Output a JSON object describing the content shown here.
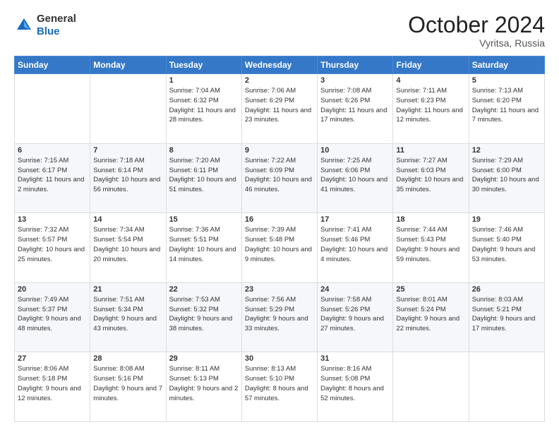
{
  "header": {
    "logo_general": "General",
    "logo_blue": "Blue",
    "month": "October 2024",
    "location": "Vyritsa, Russia"
  },
  "days_of_week": [
    "Sunday",
    "Monday",
    "Tuesday",
    "Wednesday",
    "Thursday",
    "Friday",
    "Saturday"
  ],
  "weeks": [
    [
      {
        "day": "",
        "info": ""
      },
      {
        "day": "",
        "info": ""
      },
      {
        "day": "1",
        "info": "Sunrise: 7:04 AM\nSunset: 6:32 PM\nDaylight: 11 hours and 28 minutes."
      },
      {
        "day": "2",
        "info": "Sunrise: 7:06 AM\nSunset: 6:29 PM\nDaylight: 11 hours and 23 minutes."
      },
      {
        "day": "3",
        "info": "Sunrise: 7:08 AM\nSunset: 6:26 PM\nDaylight: 11 hours and 17 minutes."
      },
      {
        "day": "4",
        "info": "Sunrise: 7:11 AM\nSunset: 6:23 PM\nDaylight: 11 hours and 12 minutes."
      },
      {
        "day": "5",
        "info": "Sunrise: 7:13 AM\nSunset: 6:20 PM\nDaylight: 11 hours and 7 minutes."
      }
    ],
    [
      {
        "day": "6",
        "info": "Sunrise: 7:15 AM\nSunset: 6:17 PM\nDaylight: 11 hours and 2 minutes."
      },
      {
        "day": "7",
        "info": "Sunrise: 7:18 AM\nSunset: 6:14 PM\nDaylight: 10 hours and 56 minutes."
      },
      {
        "day": "8",
        "info": "Sunrise: 7:20 AM\nSunset: 6:11 PM\nDaylight: 10 hours and 51 minutes."
      },
      {
        "day": "9",
        "info": "Sunrise: 7:22 AM\nSunset: 6:09 PM\nDaylight: 10 hours and 46 minutes."
      },
      {
        "day": "10",
        "info": "Sunrise: 7:25 AM\nSunset: 6:06 PM\nDaylight: 10 hours and 41 minutes."
      },
      {
        "day": "11",
        "info": "Sunrise: 7:27 AM\nSunset: 6:03 PM\nDaylight: 10 hours and 35 minutes."
      },
      {
        "day": "12",
        "info": "Sunrise: 7:29 AM\nSunset: 6:00 PM\nDaylight: 10 hours and 30 minutes."
      }
    ],
    [
      {
        "day": "13",
        "info": "Sunrise: 7:32 AM\nSunset: 5:57 PM\nDaylight: 10 hours and 25 minutes."
      },
      {
        "day": "14",
        "info": "Sunrise: 7:34 AM\nSunset: 5:54 PM\nDaylight: 10 hours and 20 minutes."
      },
      {
        "day": "15",
        "info": "Sunrise: 7:36 AM\nSunset: 5:51 PM\nDaylight: 10 hours and 14 minutes."
      },
      {
        "day": "16",
        "info": "Sunrise: 7:39 AM\nSunset: 5:48 PM\nDaylight: 10 hours and 9 minutes."
      },
      {
        "day": "17",
        "info": "Sunrise: 7:41 AM\nSunset: 5:46 PM\nDaylight: 10 hours and 4 minutes."
      },
      {
        "day": "18",
        "info": "Sunrise: 7:44 AM\nSunset: 5:43 PM\nDaylight: 9 hours and 59 minutes."
      },
      {
        "day": "19",
        "info": "Sunrise: 7:46 AM\nSunset: 5:40 PM\nDaylight: 9 hours and 53 minutes."
      }
    ],
    [
      {
        "day": "20",
        "info": "Sunrise: 7:49 AM\nSunset: 5:37 PM\nDaylight: 9 hours and 48 minutes."
      },
      {
        "day": "21",
        "info": "Sunrise: 7:51 AM\nSunset: 5:34 PM\nDaylight: 9 hours and 43 minutes."
      },
      {
        "day": "22",
        "info": "Sunrise: 7:53 AM\nSunset: 5:32 PM\nDaylight: 9 hours and 38 minutes."
      },
      {
        "day": "23",
        "info": "Sunrise: 7:56 AM\nSunset: 5:29 PM\nDaylight: 9 hours and 33 minutes."
      },
      {
        "day": "24",
        "info": "Sunrise: 7:58 AM\nSunset: 5:26 PM\nDaylight: 9 hours and 27 minutes."
      },
      {
        "day": "25",
        "info": "Sunrise: 8:01 AM\nSunset: 5:24 PM\nDaylight: 9 hours and 22 minutes."
      },
      {
        "day": "26",
        "info": "Sunrise: 8:03 AM\nSunset: 5:21 PM\nDaylight: 9 hours and 17 minutes."
      }
    ],
    [
      {
        "day": "27",
        "info": "Sunrise: 8:06 AM\nSunset: 5:18 PM\nDaylight: 9 hours and 12 minutes."
      },
      {
        "day": "28",
        "info": "Sunrise: 8:08 AM\nSunset: 5:16 PM\nDaylight: 9 hours and 7 minutes."
      },
      {
        "day": "29",
        "info": "Sunrise: 8:11 AM\nSunset: 5:13 PM\nDaylight: 9 hours and 2 minutes."
      },
      {
        "day": "30",
        "info": "Sunrise: 8:13 AM\nSunset: 5:10 PM\nDaylight: 8 hours and 57 minutes."
      },
      {
        "day": "31",
        "info": "Sunrise: 8:16 AM\nSunset: 5:08 PM\nDaylight: 8 hours and 52 minutes."
      },
      {
        "day": "",
        "info": ""
      },
      {
        "day": "",
        "info": ""
      }
    ]
  ]
}
